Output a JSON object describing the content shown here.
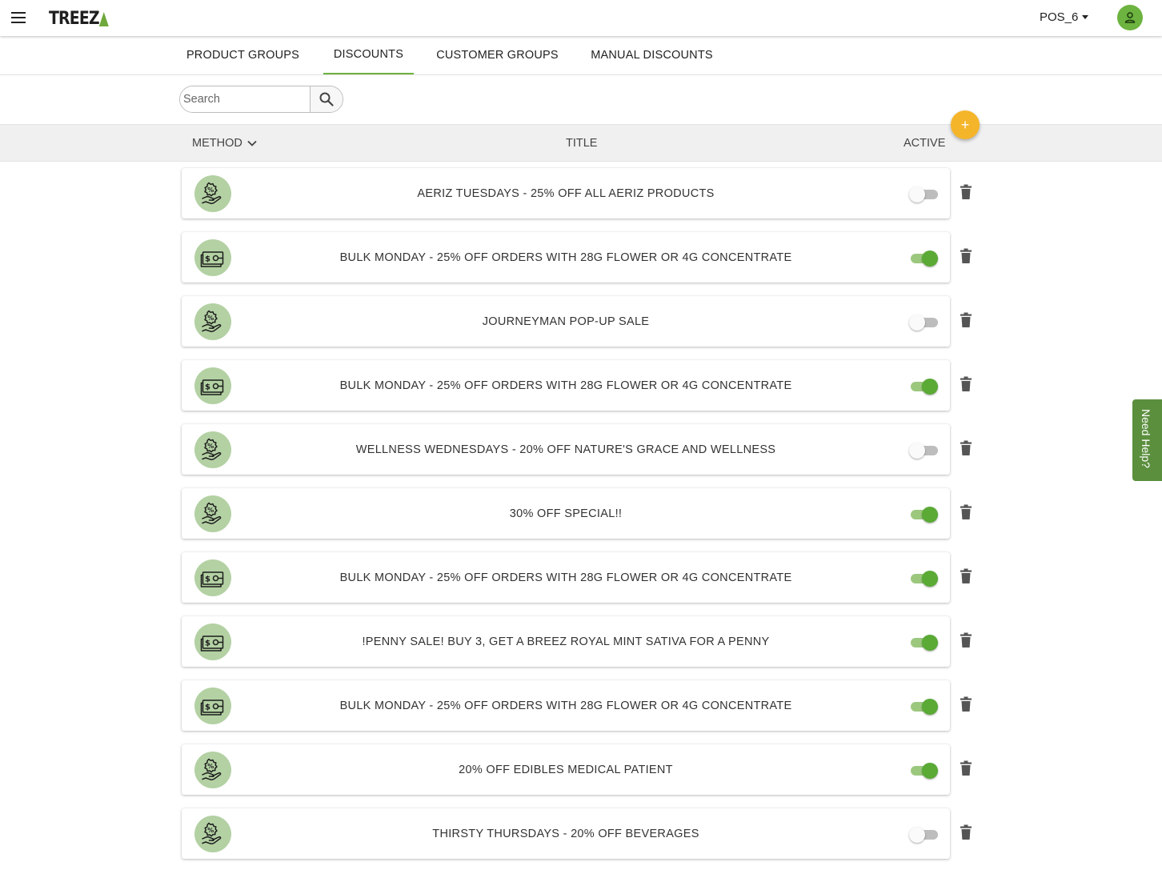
{
  "app": {
    "brand": "TREEZ",
    "pos_label": "POS_6"
  },
  "tabs": [
    {
      "label": "PRODUCT GROUPS",
      "active": false
    },
    {
      "label": "DISCOUNTS",
      "active": true
    },
    {
      "label": "CUSTOMER GROUPS",
      "active": false
    },
    {
      "label": "MANUAL DISCOUNTS",
      "active": false
    }
  ],
  "search": {
    "placeholder": "Search",
    "value": ""
  },
  "table_header": {
    "method": "METHOD",
    "title": "TITLE",
    "active": "ACTIVE"
  },
  "add_button": {
    "label": "+"
  },
  "discounts": [
    {
      "method_icon": "percent-hand-icon",
      "title": "AERIZ TUESDAYS - 25% OFF ALL AERIZ PRODUCTS",
      "active": false
    },
    {
      "method_icon": "money-tag-icon",
      "title": "BULK MONDAY - 25% OFF ORDERS WITH 28G FLOWER OR 4G CONCENTRATE",
      "active": true
    },
    {
      "method_icon": "percent-hand-icon",
      "title": "JOURNEYMAN POP-UP SALE",
      "active": false
    },
    {
      "method_icon": "money-tag-icon",
      "title": "BULK MONDAY - 25% OFF ORDERS WITH 28G FLOWER OR 4G CONCENTRATE",
      "active": true
    },
    {
      "method_icon": "percent-hand-icon",
      "title": "WELLNESS WEDNESDAYS - 20% OFF NATURE'S GRACE AND WELLNESS",
      "active": false
    },
    {
      "method_icon": "percent-hand-icon",
      "title": "30% OFF SPECIAL!!",
      "active": true
    },
    {
      "method_icon": "money-tag-icon",
      "title": "BULK MONDAY - 25% OFF ORDERS WITH 28G FLOWER OR 4G CONCENTRATE",
      "active": true
    },
    {
      "method_icon": "money-tag-icon",
      "title": "!PENNY SALE! BUY 3, GET A BREEZ ROYAL MINT SATIVA FOR A PENNY",
      "active": true
    },
    {
      "method_icon": "money-tag-icon",
      "title": "BULK MONDAY - 25% OFF ORDERS WITH 28G FLOWER OR 4G CONCENTRATE",
      "active": true
    },
    {
      "method_icon": "percent-hand-icon",
      "title": "20% OFF EDIBLES MEDICAL PATIENT",
      "active": true
    },
    {
      "method_icon": "percent-hand-icon",
      "title": "THIRSTY THURSDAYS - 20% OFF BEVERAGES",
      "active": false
    }
  ],
  "help": {
    "label": "Need Help?"
  },
  "colors": {
    "accent": "#6cb33f",
    "add_button": "#f5b52a",
    "icon_bg": "#b3d1a3",
    "help_bg": "#5b8f3e"
  }
}
